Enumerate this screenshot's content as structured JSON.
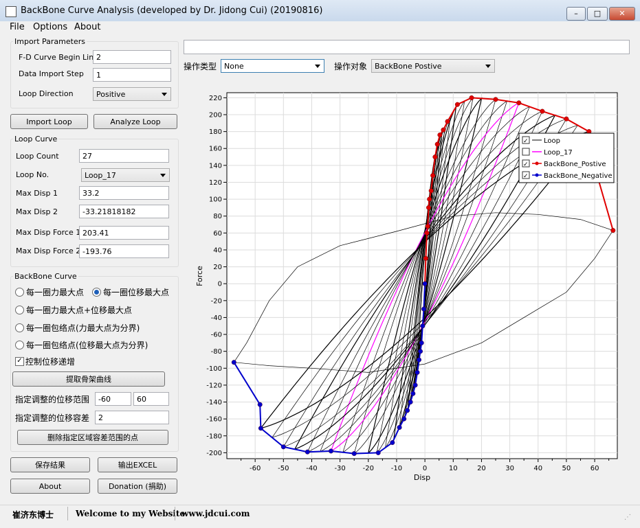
{
  "window": {
    "title": "BackBone Curve Analysis (developed by Dr. Jidong Cui) (20190816)",
    "minimize": "–",
    "maximize": "□",
    "close": "✕"
  },
  "menu": [
    "File",
    "Options",
    "About"
  ],
  "import": {
    "group": "Import Parameters",
    "begin_line_label": "F-D Curve Begin Line",
    "begin_line": "2",
    "step_label": "Data Import Step",
    "step": "1",
    "direction_label": "Loop Direction",
    "direction": "Positive",
    "import_btn": "Import Loop",
    "analyze_btn": "Analyze Loop"
  },
  "loop": {
    "group": "Loop Curve",
    "count_label": "Loop Count",
    "count": "27",
    "no_label": "Loop No.",
    "no": "Loop_17",
    "maxdisp1_label": "Max Disp 1",
    "maxdisp1": "33.2",
    "maxdisp2_label": "Max Disp 2",
    "maxdisp2": "-33.21818182",
    "maxforce1_label": "Max Disp Force 1",
    "maxforce1": "203.41",
    "maxforce2_label": "Max Disp Force 2",
    "maxforce2": "-193.76"
  },
  "backbone": {
    "group": "BackBone Curve",
    "r1": "每一圈力最大点",
    "r2": "每一圈位移最大点",
    "r3": "每一圈力最大点+位移最大点",
    "r4": "每一圈包络点(力最大点为分界)",
    "r5": "每一圈包络点(位移最大点为分界)",
    "check": "控制位移递增",
    "check_mark": "✓",
    "extract_btn": "提取骨架曲线",
    "range_label": "指定调整的位移范围",
    "range_min": "-60",
    "range_max": "60",
    "tol_label": "指定调整的位移容差",
    "tol": "2",
    "delete_btn": "删除指定区域容差范围的点"
  },
  "buttons": {
    "save": "保存结果",
    "excel": "输出EXCEL",
    "about": "About",
    "donation": "Donation (捐助)"
  },
  "toolbar": {
    "op_type_label": "操作类型",
    "op_type": "None",
    "op_obj_label": "操作对象",
    "op_obj": "BackBone Postive"
  },
  "status": {
    "name": "崔济东博士",
    "welcome": "Welcome to my Website",
    "url": "www.jdcui.com"
  },
  "colors": {
    "positive": "#e00000",
    "negative": "#0000cc",
    "loop": "#000000",
    "loop17": "#ff00ff"
  },
  "chart_data": {
    "type": "line",
    "xlabel": "Disp",
    "ylabel": "Force",
    "xlim": [
      -70,
      68
    ],
    "ylim": [
      -207,
      226
    ],
    "xticks": [
      -60,
      -50,
      -40,
      -30,
      -20,
      -10,
      0,
      10,
      20,
      30,
      40,
      50,
      60
    ],
    "yticks": [
      220,
      200,
      180,
      160,
      140,
      120,
      100,
      80,
      60,
      40,
      20,
      0,
      -20,
      -40,
      -60,
      -80,
      -100,
      -120,
      -140,
      -160,
      -180,
      -200
    ],
    "grid": true,
    "legend_position": "top-right",
    "legend": [
      "Loop",
      "Loop_17",
      "BackBone_Postive",
      "BackBone_Negative"
    ],
    "series": [
      {
        "name": "BackBone_Postive",
        "x": [
          0,
          0.3,
          0.7,
          1,
          1.3,
          1.6,
          2.2,
          2.8,
          3.6,
          4.4,
          5.3,
          6.5,
          8,
          11.5,
          16.5,
          25,
          33.2,
          41.5,
          50,
          58,
          58.3,
          66.5
        ],
        "y": [
          0,
          30,
          60,
          68,
          90,
          100,
          110,
          128,
          150,
          165,
          176,
          182,
          192,
          212,
          220,
          218,
          214,
          204,
          195,
          180,
          158,
          63
        ]
      },
      {
        "name": "BackBone_Negative",
        "x": [
          0,
          -0.4,
          -0.8,
          -1.2,
          -1.6,
          -2.1,
          -2.7,
          -3.4,
          -4.2,
          -5.1,
          -6.2,
          -7.4,
          -9,
          -11.5,
          -16.5,
          -25,
          -33.2,
          -41.5,
          -50,
          -58,
          -58.3,
          -67.5
        ],
        "y": [
          0,
          -30,
          -50,
          -70,
          -80,
          -90,
          -105,
          -120,
          -130,
          -140,
          -150,
          -160,
          -170,
          -188,
          -200,
          -201,
          -198,
          -199,
          -193,
          -171,
          -143,
          -93
        ]
      }
    ]
  }
}
